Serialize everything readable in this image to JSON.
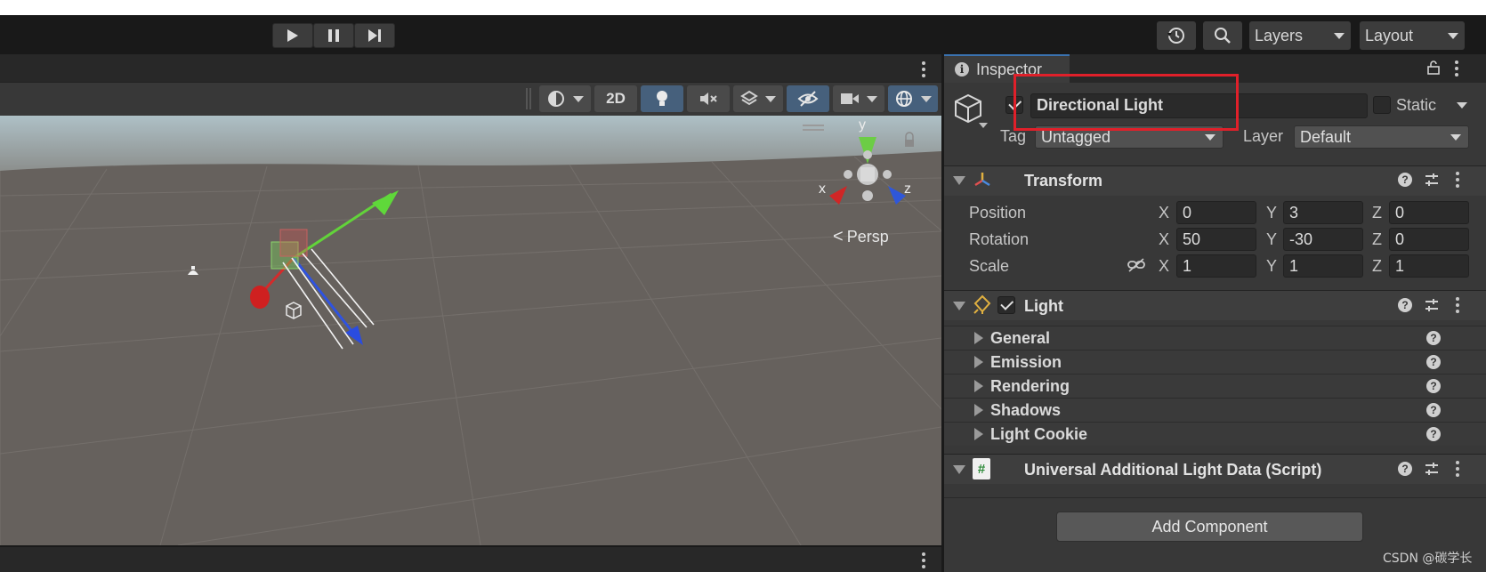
{
  "toolbar": {
    "play_icon": "play-icon",
    "pause_icon": "pause-icon",
    "step_icon": "step-icon",
    "history_icon": "history-icon",
    "search_icon": "search-icon",
    "layers_label": "Layers",
    "layout_label": "Layout"
  },
  "scene": {
    "toolbar": {
      "btn_2d": "2D"
    },
    "persp_label": "Persp",
    "gizmo": {
      "y": "y",
      "x": "x",
      "z": "z"
    }
  },
  "inspector": {
    "tab_label": "Inspector",
    "header": {
      "active": true,
      "name": "Directional Light",
      "static_label": "Static",
      "tag_label": "Tag",
      "tag_value": "Untagged",
      "layer_label": "Layer",
      "layer_value": "Default"
    },
    "transform": {
      "title": "Transform",
      "rows": [
        {
          "label": "Position",
          "x": "0",
          "y": "3",
          "z": "0"
        },
        {
          "label": "Rotation",
          "x": "50",
          "y": "-30",
          "z": "0"
        },
        {
          "label": "Scale",
          "x": "1",
          "y": "1",
          "z": "1"
        }
      ],
      "axis_x": "X",
      "axis_y": "Y",
      "axis_z": "Z"
    },
    "light": {
      "title": "Light",
      "enabled": true,
      "sections": [
        "General",
        "Emission",
        "Rendering",
        "Shadows",
        "Light Cookie"
      ]
    },
    "script": {
      "title": "Universal Additional Light Data (Script)"
    },
    "add_component_label": "Add Component"
  },
  "watermark": "CSDN @碳学长",
  "colors": {
    "panel": "#383838",
    "toolbar": "#191919",
    "active_button": "#46607c",
    "highlight": "#e0202a"
  }
}
